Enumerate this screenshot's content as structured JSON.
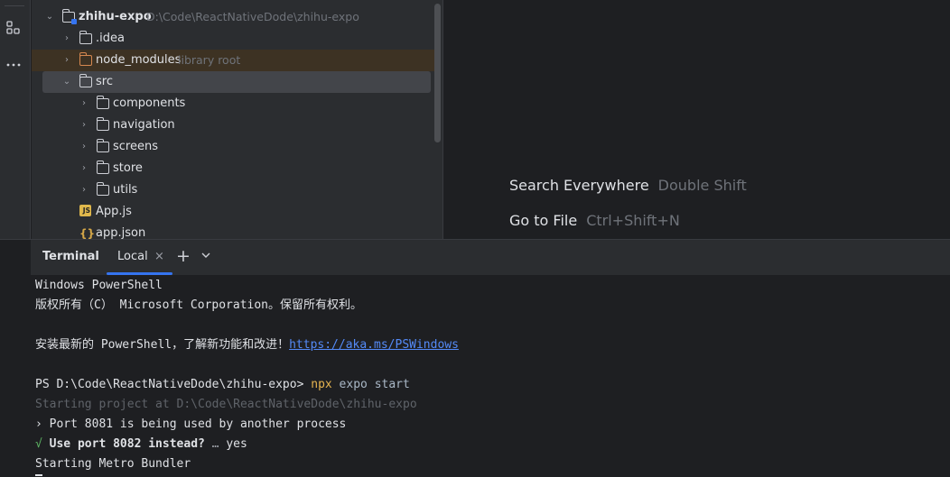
{
  "activity_bar": {
    "icons": [
      "structure-icon",
      "more-icon"
    ]
  },
  "tree": {
    "root": {
      "name": "zhihu-expo",
      "path": "D:\\Code\\ReactNativeDode\\zhihu-expo"
    },
    "idea": {
      "name": ".idea"
    },
    "node_modules": {
      "name": "node_modules",
      "tag": "library root"
    },
    "src": {
      "name": "src"
    },
    "src_children": [
      "components",
      "navigation",
      "screens",
      "store",
      "utils"
    ],
    "app_js": {
      "name": "App.js",
      "icon_text": "JS"
    },
    "app_json": {
      "name": "app.json",
      "icon_text": "{}"
    }
  },
  "editor": {
    "hints": [
      {
        "action": "Search Everywhere",
        "keys": "Double Shift"
      },
      {
        "action": "Go to File",
        "keys": "Ctrl+Shift+N"
      }
    ]
  },
  "terminal": {
    "title": "Terminal",
    "tab": {
      "label": "Local",
      "close": "×"
    },
    "add": "+",
    "dropdown": "⌄",
    "lines": {
      "l1": "Windows PowerShell",
      "l2": "版权所有（C） Microsoft Corporation。保留所有权利。",
      "l3_text": "安装最新的 PowerShell，了解新功能和改进！",
      "l3_link": "https://aka.ms/PSWindows",
      "l4_prompt": "PS D:\\Code\\ReactNativeDode\\zhihu-expo> ",
      "l4_cmd": "npx",
      "l4_args": " expo start",
      "l5": "Starting project at D:\\Code\\ReactNativeDode\\zhihu-expo",
      "l6": "› Port 8081 is being used by another process",
      "l7_check": "√",
      "l7_q": " Use port 8082 instead?",
      "l7_dots": " … ",
      "l7_ans": "yes",
      "l8": "Starting Metro Bundler"
    }
  },
  "colors": {
    "accent": "#3574f0",
    "library_highlight": "#3d3223",
    "command": "#e6b450",
    "link": "#548af7"
  }
}
